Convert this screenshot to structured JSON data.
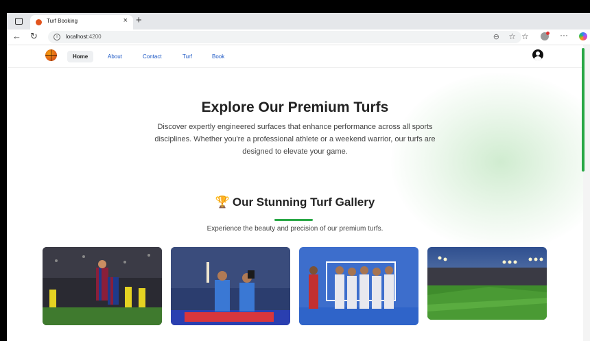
{
  "browser": {
    "tab": {
      "title": "Turf Booking"
    },
    "address": {
      "host": "localhost",
      "port": ":4200"
    }
  },
  "site": {
    "nav": [
      {
        "label": "Home",
        "active": true
      },
      {
        "label": "About",
        "active": false
      },
      {
        "label": "Contact",
        "active": false
      },
      {
        "label": "Turf",
        "active": false
      },
      {
        "label": "Book",
        "active": false
      }
    ]
  },
  "hero": {
    "title": "Explore Our Premium Turfs",
    "description": "Discover expertly engineered surfaces that enhance performance across all sports disciplines. Whether you're a professional athlete or a weekend warrior, our turfs are designed to elevate your game."
  },
  "gallery": {
    "icon": "trophy-icon",
    "title": "Our Stunning Turf Gallery",
    "subtitle": "Experience the beauty and precision of our premium turfs.",
    "images": [
      {
        "subject": "football-celebration"
      },
      {
        "subject": "cricket-celebration"
      },
      {
        "subject": "hockey-team"
      },
      {
        "subject": "stadium-at-dusk"
      }
    ]
  },
  "colors": {
    "accent": "#28a745",
    "link": "#1a56c4"
  }
}
